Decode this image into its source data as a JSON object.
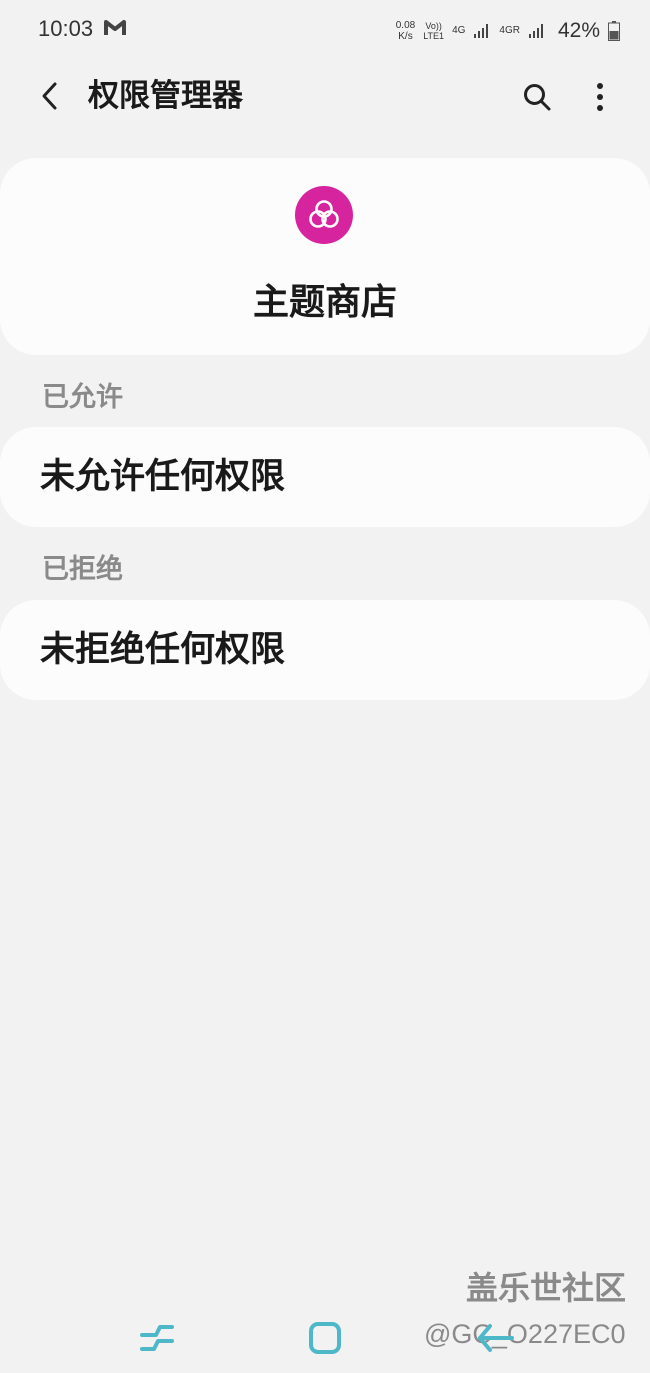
{
  "status_bar": {
    "time": "10:03",
    "net_speed_value": "0.08",
    "net_speed_unit": "K/s",
    "volte_top": "Vo))",
    "volte_bottom": "LTE1",
    "network_1": "4G",
    "network_2": "4GR",
    "battery": "42%"
  },
  "header": {
    "title": "权限管理器"
  },
  "app": {
    "name": "主题商店",
    "icon": "theme-store-icon",
    "icon_color": "#d6249f"
  },
  "sections": {
    "allowed": {
      "label": "已允许",
      "empty_text": "未允许任何权限"
    },
    "denied": {
      "label": "已拒绝",
      "empty_text": "未拒绝任何权限"
    }
  },
  "watermark": {
    "title": "盖乐世社区",
    "handle": "@GC_O227EC0"
  },
  "colors": {
    "background": "#f2f2f2",
    "card": "#fcfcfc",
    "nav_icon": "#4fb8c8"
  }
}
